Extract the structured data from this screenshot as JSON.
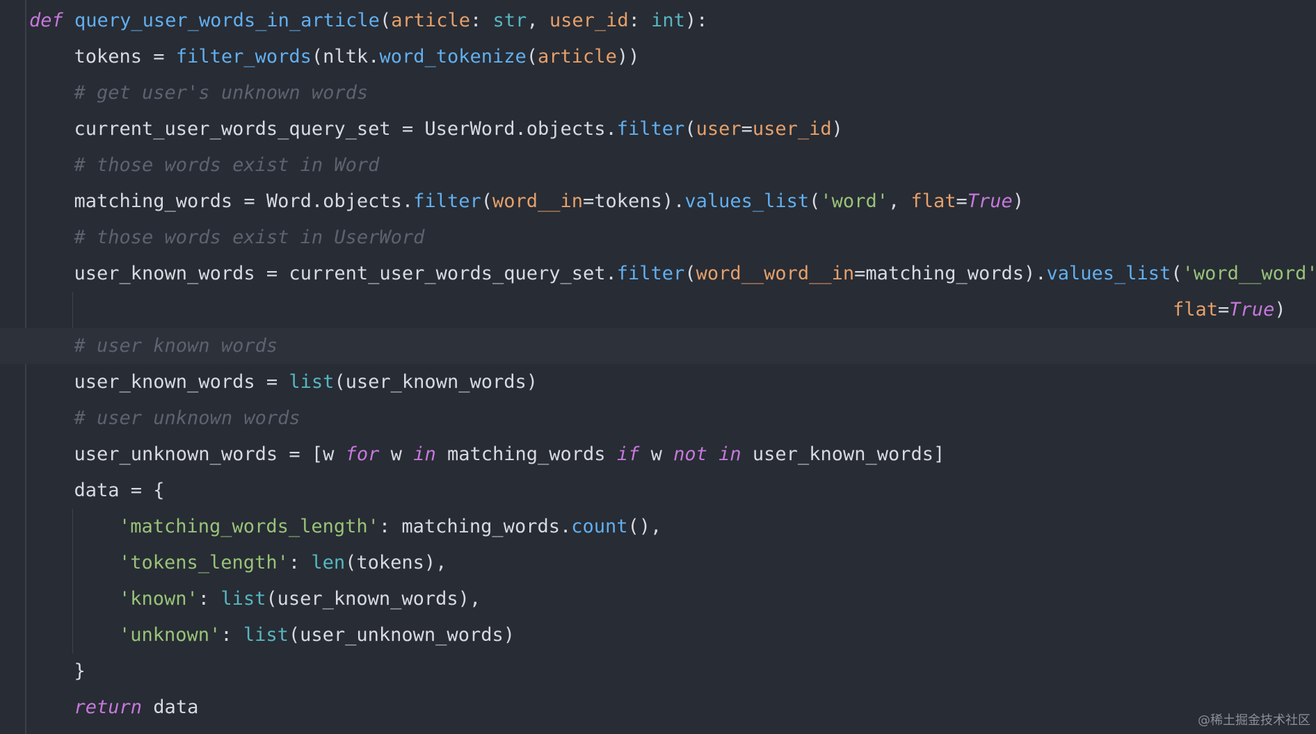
{
  "editor": {
    "lines": [
      {
        "indent": 0,
        "tokens": [
          {
            "t": "def",
            "c": "kw"
          },
          {
            "t": " ",
            "c": "pl"
          },
          {
            "t": "query_user_words_in_article",
            "c": "fn"
          },
          {
            "t": "(",
            "c": "pl"
          },
          {
            "t": "article",
            "c": "pm"
          },
          {
            "t": ": ",
            "c": "pl"
          },
          {
            "t": "str",
            "c": "bi"
          },
          {
            "t": ", ",
            "c": "pl"
          },
          {
            "t": "user_id",
            "c": "pm"
          },
          {
            "t": ": ",
            "c": "pl"
          },
          {
            "t": "int",
            "c": "bi"
          },
          {
            "t": "):",
            "c": "pl"
          }
        ]
      },
      {
        "indent": 1,
        "tokens": [
          {
            "t": "tokens = ",
            "c": "pl"
          },
          {
            "t": "filter_words",
            "c": "fn"
          },
          {
            "t": "(nltk.",
            "c": "pl"
          },
          {
            "t": "word_tokenize",
            "c": "fn"
          },
          {
            "t": "(",
            "c": "pl"
          },
          {
            "t": "article",
            "c": "pm"
          },
          {
            "t": "))",
            "c": "pl"
          }
        ]
      },
      {
        "indent": 1,
        "tokens": [
          {
            "t": "# get user's unknown words",
            "c": "cm"
          }
        ]
      },
      {
        "indent": 1,
        "tokens": [
          {
            "t": "current_user_words_query_set = UserWord.objects.",
            "c": "pl"
          },
          {
            "t": "filter",
            "c": "fn"
          },
          {
            "t": "(",
            "c": "pl"
          },
          {
            "t": "user",
            "c": "pm"
          },
          {
            "t": "=",
            "c": "pl"
          },
          {
            "t": "user_id",
            "c": "pm"
          },
          {
            "t": ")",
            "c": "pl"
          }
        ]
      },
      {
        "indent": 1,
        "tokens": [
          {
            "t": "# those words exist in Word",
            "c": "cm"
          }
        ]
      },
      {
        "indent": 1,
        "tokens": [
          {
            "t": "matching_words = Word.objects.",
            "c": "pl"
          },
          {
            "t": "filter",
            "c": "fn"
          },
          {
            "t": "(",
            "c": "pl"
          },
          {
            "t": "word__in",
            "c": "pm"
          },
          {
            "t": "=tokens).",
            "c": "pl"
          },
          {
            "t": "values_list",
            "c": "fn"
          },
          {
            "t": "(",
            "c": "pl"
          },
          {
            "t": "'word'",
            "c": "st"
          },
          {
            "t": ", ",
            "c": "pl"
          },
          {
            "t": "flat",
            "c": "pm"
          },
          {
            "t": "=",
            "c": "pl"
          },
          {
            "t": "True",
            "c": "kw"
          },
          {
            "t": ")",
            "c": "pl"
          }
        ]
      },
      {
        "indent": 1,
        "tokens": [
          {
            "t": "# those words exist in UserWord",
            "c": "cm"
          }
        ]
      },
      {
        "indent": 1,
        "tokens": [
          {
            "t": "user_known_words = current_user_words_query_set.",
            "c": "pl"
          },
          {
            "t": "filter",
            "c": "fn"
          },
          {
            "t": "(",
            "c": "pl"
          },
          {
            "t": "word__word__in",
            "c": "pm"
          },
          {
            "t": "=matching_words).",
            "c": "pl"
          },
          {
            "t": "values_list",
            "c": "fn"
          },
          {
            "t": "(",
            "c": "pl"
          },
          {
            "t": "'word__word'",
            "c": "st"
          },
          {
            "t": ",",
            "c": "pl"
          }
        ]
      },
      {
        "indent": 0,
        "wrap": true,
        "tokens": [
          {
            "t": "flat",
            "c": "pm"
          },
          {
            "t": "=",
            "c": "pl"
          },
          {
            "t": "True",
            "c": "kw"
          },
          {
            "t": ")",
            "c": "pl"
          }
        ]
      },
      {
        "indent": 1,
        "current": true,
        "tokens": [
          {
            "t": "# user known words",
            "c": "cm"
          }
        ]
      },
      {
        "indent": 1,
        "tokens": [
          {
            "t": "user_known_words = ",
            "c": "pl"
          },
          {
            "t": "list",
            "c": "bi"
          },
          {
            "t": "(user_known_words)",
            "c": "pl"
          }
        ]
      },
      {
        "indent": 1,
        "tokens": [
          {
            "t": "# user unknown words",
            "c": "cm"
          }
        ]
      },
      {
        "indent": 1,
        "tokens": [
          {
            "t": "user_unknown_words = [w ",
            "c": "pl"
          },
          {
            "t": "for",
            "c": "kw"
          },
          {
            "t": " w ",
            "c": "pl"
          },
          {
            "t": "in",
            "c": "kw"
          },
          {
            "t": " matching_words ",
            "c": "pl"
          },
          {
            "t": "if",
            "c": "kw"
          },
          {
            "t": " w ",
            "c": "pl"
          },
          {
            "t": "not in",
            "c": "kw"
          },
          {
            "t": " user_known_words]",
            "c": "pl"
          }
        ]
      },
      {
        "indent": 1,
        "tokens": [
          {
            "t": "data = {",
            "c": "pl"
          }
        ]
      },
      {
        "indent": 2,
        "tokens": [
          {
            "t": "'matching_words_length'",
            "c": "st"
          },
          {
            "t": ": matching_words.",
            "c": "pl"
          },
          {
            "t": "count",
            "c": "fn"
          },
          {
            "t": "(),",
            "c": "pl"
          }
        ]
      },
      {
        "indent": 2,
        "tokens": [
          {
            "t": "'tokens_length'",
            "c": "st"
          },
          {
            "t": ": ",
            "c": "pl"
          },
          {
            "t": "len",
            "c": "bi"
          },
          {
            "t": "(tokens),",
            "c": "pl"
          }
        ]
      },
      {
        "indent": 2,
        "tokens": [
          {
            "t": "'known'",
            "c": "st"
          },
          {
            "t": ": ",
            "c": "pl"
          },
          {
            "t": "list",
            "c": "bi"
          },
          {
            "t": "(user_known_words),",
            "c": "pl"
          }
        ]
      },
      {
        "indent": 2,
        "tokens": [
          {
            "t": "'unknown'",
            "c": "st"
          },
          {
            "t": ": ",
            "c": "pl"
          },
          {
            "t": "list",
            "c": "bi"
          },
          {
            "t": "(user_unknown_words)",
            "c": "pl"
          }
        ]
      },
      {
        "indent": 1,
        "tokens": [
          {
            "t": "}",
            "c": "pl"
          }
        ]
      },
      {
        "indent": 1,
        "tokens": [
          {
            "t": "return",
            "c": "kw"
          },
          {
            "t": " data",
            "c": "pl"
          }
        ]
      }
    ]
  },
  "watermark": "@稀土掘金技术社区",
  "colors": {
    "background": "#282c34",
    "keyword": "#c678dd",
    "function": "#61afef",
    "builtin": "#56b6c2",
    "parameter": "#e5a06b",
    "string": "#98c379",
    "comment": "#5c6370",
    "plain": "#d7dae0"
  }
}
